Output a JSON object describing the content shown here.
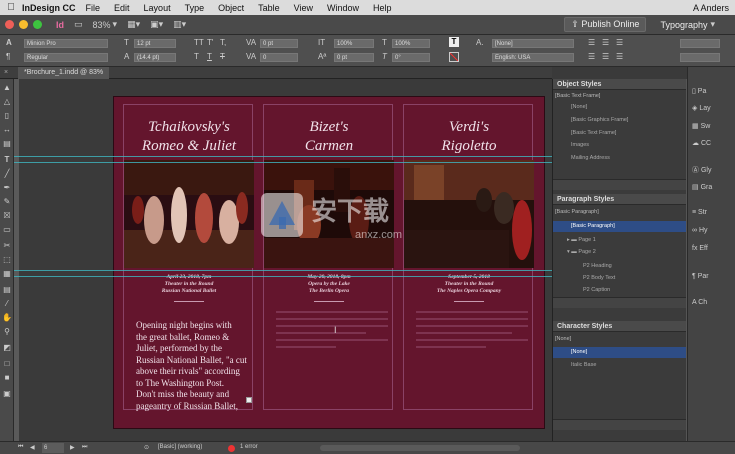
{
  "menubar": {
    "apple": "",
    "app": "InDesign CC",
    "items": [
      "File",
      "Edit",
      "Layout",
      "Type",
      "Object",
      "Table",
      "View",
      "Window",
      "Help"
    ],
    "user": "A Anders"
  },
  "appbar": {
    "zoom": "83%",
    "publish": "Publish Online",
    "workspace": "Typography"
  },
  "control": {
    "font_family": "Minion Pro",
    "font_style": "Regular",
    "font_size": "12 pt",
    "leading": "(14.4 pt)",
    "kerning": "0 pt",
    "tracking": "0",
    "scale_v": "100%",
    "scale_h": "100%",
    "baseline": "0 pt",
    "angle": "0°",
    "lang_char": "[None]",
    "language": "English: USA",
    "case_buttons": [
      "TT",
      "T'",
      "T,",
      "T",
      "T",
      "T"
    ]
  },
  "document": {
    "tab": "*Brochure_1.indd @ 83%"
  },
  "columns": [
    {
      "title1": "Tchaikovsky's",
      "title2": "Romeo & Juliet",
      "date": "April 23, 2018, 7pm",
      "venue": "Theater in the Round",
      "company": "Russian National Ballet"
    },
    {
      "title1": "Bizet's",
      "title2": "Carmen",
      "date": "May 20, 2018, 8pm",
      "venue": "Opera by the Lake",
      "company": "The Berlin Opera"
    },
    {
      "title1": "Verdi's",
      "title2": "Rigoletto",
      "date": "September 5, 2018",
      "venue": "Theater in the Round",
      "company": "The Naples Opera Company"
    }
  ],
  "body_text": [
    "Opening night begins with",
    "the great ballet, Romeo &",
    "Juliet, performed by the",
    "Russian National Ballet, \"a cut",
    "above their rivals\" according",
    "to The Washington Post.",
    "Don't miss the beauty and",
    "pageantry of Russian Ballet,"
  ],
  "object_styles": {
    "title": "Object Styles",
    "current": "[Basic Text Frame]",
    "items": [
      "[None]",
      "[Basic Graphics Frame]",
      "[Basic Text Frame]",
      "Images",
      "Mailing Address"
    ]
  },
  "paragraph_styles": {
    "title": "Paragraph Styles",
    "current": "[Basic Paragraph]",
    "items": [
      "[Basic Paragraph]",
      "Page 1",
      "Page 2",
      "P2 Heading",
      "P2 Body Text",
      "P2 Caption"
    ]
  },
  "character_styles": {
    "title": "Character Styles",
    "current": "[None]",
    "items": [
      "[None]",
      "Italic Base"
    ]
  },
  "right_panel": [
    "Pa",
    "Lay",
    "Sw",
    "CC",
    "Gly",
    "Gra",
    "Str",
    "Hy",
    "Eff",
    "Par",
    "Ch"
  ],
  "status": {
    "page": "6",
    "style": "[Basic] (working)",
    "errors": "1 error"
  },
  "watermark": {
    "cn": "安下载",
    "latin": "anxz.com"
  },
  "colors": {
    "page_bg": "#64152d",
    "guide": "#3fb6c0",
    "selection": "#2e4d86",
    "title_text": "#f1e2ea"
  }
}
